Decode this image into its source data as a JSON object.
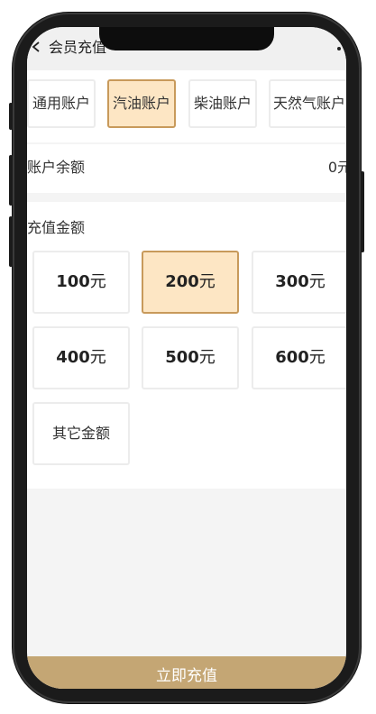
{
  "header": {
    "title": "会员充值"
  },
  "tabs": [
    {
      "label": "通用账户",
      "active": false
    },
    {
      "label": "汽油账户",
      "active": true
    },
    {
      "label": "柴油账户",
      "active": false
    },
    {
      "label": "天然气账户",
      "active": false
    }
  ],
  "balance": {
    "label": "账户余额",
    "value": "0元"
  },
  "amounts": {
    "title": "充值金额",
    "unit": "元",
    "options": [
      {
        "value": "100",
        "active": false
      },
      {
        "value": "200",
        "active": true
      },
      {
        "value": "300",
        "active": false
      },
      {
        "value": "400",
        "active": false
      },
      {
        "value": "500",
        "active": false
      },
      {
        "value": "600",
        "active": false
      }
    ],
    "other_label": "其它金额"
  },
  "footer": {
    "submit_label": "立即充值"
  },
  "colors": {
    "accent": "#c4a674",
    "selected_bg": "#fde6c4",
    "selected_border": "#c89a5b"
  }
}
